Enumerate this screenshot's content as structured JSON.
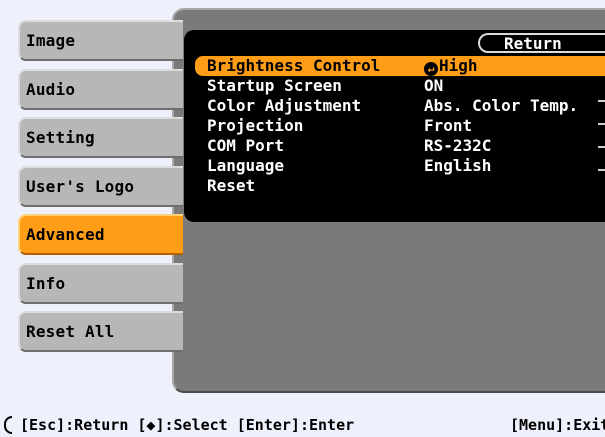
{
  "menu": {
    "items": [
      {
        "label": "Image",
        "active": false
      },
      {
        "label": "Audio",
        "active": false
      },
      {
        "label": "Setting",
        "active": false
      },
      {
        "label": "User's Logo",
        "active": false
      },
      {
        "label": "Advanced",
        "active": true
      },
      {
        "label": "Info",
        "active": false
      },
      {
        "label": "Reset All",
        "active": false
      }
    ]
  },
  "panel": {
    "return_label": "Return",
    "rows": [
      {
        "label": "Brightness Control",
        "value": "High",
        "selected": true
      },
      {
        "label": "Startup Screen",
        "value": "ON",
        "selected": false
      },
      {
        "label": "Color Adjustment",
        "value": "Abs. Color Temp.",
        "selected": false
      },
      {
        "label": "Projection",
        "value": "Front",
        "selected": false
      },
      {
        "label": "COM Port",
        "value": "RS-232C",
        "selected": false
      },
      {
        "label": "Language",
        "value": "English",
        "selected": false
      },
      {
        "label": "Reset",
        "value": "",
        "selected": false
      }
    ]
  },
  "footer": {
    "left_text": "[Esc]:Return [◆]:Select [Enter]:Enter",
    "right_text": "[Menu]:Exit"
  },
  "colors": {
    "accent": "#ff9e16",
    "tab": "#b7b7b7",
    "panel": "#7a7a7a",
    "inner": "#000000",
    "background": "#eef0fb"
  },
  "icons": {
    "enter_icon": "enter-arrow-icon",
    "updown_icon": "up-down-arrow-icon"
  }
}
